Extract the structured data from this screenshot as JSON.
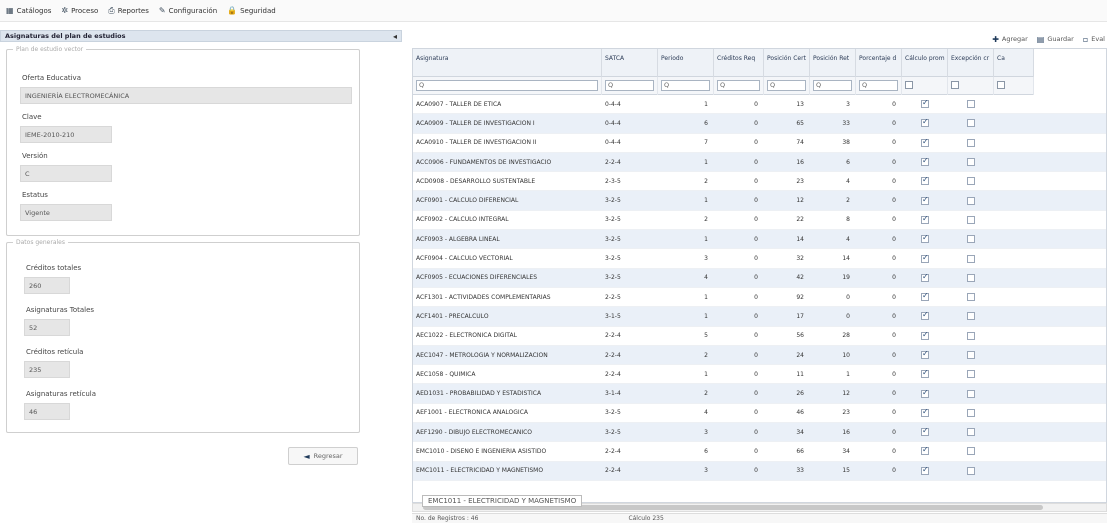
{
  "menu": [
    {
      "icon": "grid-icon",
      "label": "Catálogos",
      "glyph": "▦"
    },
    {
      "icon": "gear-icon",
      "label": "Proceso",
      "glyph": "✲"
    },
    {
      "icon": "print-icon",
      "label": "Reportes",
      "glyph": "⎙"
    },
    {
      "icon": "wrench-icon",
      "label": "Configuración",
      "glyph": "✎"
    },
    {
      "icon": "lock-icon",
      "label": "Seguridad",
      "glyph": "🔒"
    }
  ],
  "left": {
    "title": "Asignaturas del plan de estudios",
    "collapse_glyph": "◂",
    "plan": {
      "legend": "Plan de estudio vector",
      "oferta_label": "Oferta Educativa",
      "oferta_value": "INGENIERÍA ELECTROMECÁNICA",
      "clave_label": "Clave",
      "clave_value": "IEME-2010-210",
      "version_label": "Versión",
      "version_value": "C",
      "estatus_label": "Estatus",
      "estatus_value": "Vigente"
    },
    "datos": {
      "legend": "Datos generales",
      "creditos_label": "Créditos totales",
      "creditos_value": "260",
      "asig_label": "Asignaturas Totales",
      "asig_value": "52",
      "cred_ret_label": "Créditos retícula",
      "cred_ret_value": "235",
      "asig_ret_label": "Asignaturas retícula",
      "asig_ret_value": "46"
    },
    "back_label": "Regresar"
  },
  "toolbar": {
    "add_label": "Agregar",
    "save_label": "Guardar",
    "edit_label": "Eval"
  },
  "grid": {
    "columns": [
      "Asignatura",
      "SATCA",
      "Periodo",
      "Créditos Req",
      "Posición Cert",
      "Posición Ret",
      "Porcentaje d",
      "Cálculo prom",
      "Excepción cr",
      "Ca"
    ],
    "filter_placeholder": "Q",
    "rows": [
      {
        "asig": "ACA0907 - TALLER DE ETICA",
        "satca": "0-4-4",
        "periodo": "1",
        "cred": "0",
        "pcert": "13",
        "pret": "3",
        "porc": "0",
        "calc": true,
        "exc": false
      },
      {
        "asig": "ACA0909 - TALLER DE INVESTIGACION I",
        "satca": "0-4-4",
        "periodo": "6",
        "cred": "0",
        "pcert": "65",
        "pret": "33",
        "porc": "0",
        "calc": true,
        "exc": false
      },
      {
        "asig": "ACA0910 - TALLER DE INVESTIGACION II",
        "satca": "0-4-4",
        "periodo": "7",
        "cred": "0",
        "pcert": "74",
        "pret": "38",
        "porc": "0",
        "calc": true,
        "exc": false
      },
      {
        "asig": "ACC0906 - FUNDAMENTOS DE INVESTIGACIÓ",
        "satca": "2-2-4",
        "periodo": "1",
        "cred": "0",
        "pcert": "16",
        "pret": "6",
        "porc": "0",
        "calc": true,
        "exc": false
      },
      {
        "asig": "ACD0908 - DESARROLLO SUSTENTABLE",
        "satca": "2-3-5",
        "periodo": "2",
        "cred": "0",
        "pcert": "23",
        "pret": "4",
        "porc": "0",
        "calc": true,
        "exc": false
      },
      {
        "asig": "ACF0901 - CALCULO DIFERENCIAL",
        "satca": "3-2-5",
        "periodo": "1",
        "cred": "0",
        "pcert": "12",
        "pret": "2",
        "porc": "0",
        "calc": true,
        "exc": false
      },
      {
        "asig": "ACF0902 - CÁLCULO INTEGRAL",
        "satca": "3-2-5",
        "periodo": "2",
        "cred": "0",
        "pcert": "22",
        "pret": "8",
        "porc": "0",
        "calc": true,
        "exc": false
      },
      {
        "asig": "ACF0903 - ALGEBRA LINEAL",
        "satca": "3-2-5",
        "periodo": "1",
        "cred": "0",
        "pcert": "14",
        "pret": "4",
        "porc": "0",
        "calc": true,
        "exc": false
      },
      {
        "asig": "ACF0904 - CALCULO VECTORIAL",
        "satca": "3-2-5",
        "periodo": "3",
        "cred": "0",
        "pcert": "32",
        "pret": "14",
        "porc": "0",
        "calc": true,
        "exc": false
      },
      {
        "asig": "ACF0905 - ECUACIONES DIFERENCIALES",
        "satca": "3-2-5",
        "periodo": "4",
        "cred": "0",
        "pcert": "42",
        "pret": "19",
        "porc": "0",
        "calc": true,
        "exc": false
      },
      {
        "asig": "ACF1301 - ACTIVIDADES COMPLEMENTARIAS",
        "satca": "2-2-5",
        "periodo": "1",
        "cred": "0",
        "pcert": "92",
        "pret": "0",
        "porc": "0",
        "calc": true,
        "exc": false
      },
      {
        "asig": "ACF1401 - PRECALCULO",
        "satca": "3-1-5",
        "periodo": "1",
        "cred": "0",
        "pcert": "17",
        "pret": "0",
        "porc": "0",
        "calc": true,
        "exc": false
      },
      {
        "asig": "AEC1022 - ELECTRONICA DIGITAL",
        "satca": "2-2-4",
        "periodo": "5",
        "cred": "0",
        "pcert": "56",
        "pret": "28",
        "porc": "0",
        "calc": true,
        "exc": false
      },
      {
        "asig": "AEC1047 - METROLOGIA Y NORMALIZACION",
        "satca": "2-2-4",
        "periodo": "2",
        "cred": "0",
        "pcert": "24",
        "pret": "10",
        "porc": "0",
        "calc": true,
        "exc": false
      },
      {
        "asig": "AEC1058 - QUIMICA",
        "satca": "2-2-4",
        "periodo": "1",
        "cred": "0",
        "pcert": "11",
        "pret": "1",
        "porc": "0",
        "calc": true,
        "exc": false
      },
      {
        "asig": "AED1031 - PROBABILIDAD Y ESTADÍSTICA",
        "satca": "3-1-4",
        "periodo": "2",
        "cred": "0",
        "pcert": "26",
        "pret": "12",
        "porc": "0",
        "calc": true,
        "exc": false
      },
      {
        "asig": "AEF1001 - ELECTRONICA ANALOGICA",
        "satca": "3-2-5",
        "periodo": "4",
        "cred": "0",
        "pcert": "46",
        "pret": "23",
        "porc": "0",
        "calc": true,
        "exc": false
      },
      {
        "asig": "AEF1290 - DIBUJO ELECTROMECANICO",
        "satca": "3-2-5",
        "periodo": "3",
        "cred": "0",
        "pcert": "34",
        "pret": "16",
        "porc": "0",
        "calc": true,
        "exc": false
      },
      {
        "asig": "EMC1010 - DISEÑO E INGENIERIA ASISTIDO",
        "satca": "2-2-4",
        "periodo": "6",
        "cred": "0",
        "pcert": "66",
        "pret": "34",
        "porc": "0",
        "calc": true,
        "exc": false
      },
      {
        "asig": "EMC1011 - ELECTRICIDAD Y MAGNETISMO",
        "satca": "2-2-4",
        "periodo": "3",
        "cred": "0",
        "pcert": "33",
        "pret": "15",
        "porc": "0",
        "calc": true,
        "exc": false
      }
    ],
    "tooltip": "EMC1011 - ELECTRICIDAD Y MAGNETISMO",
    "footer_left": "No. de Registros : 46",
    "footer_right": "Cálculo 235"
  }
}
